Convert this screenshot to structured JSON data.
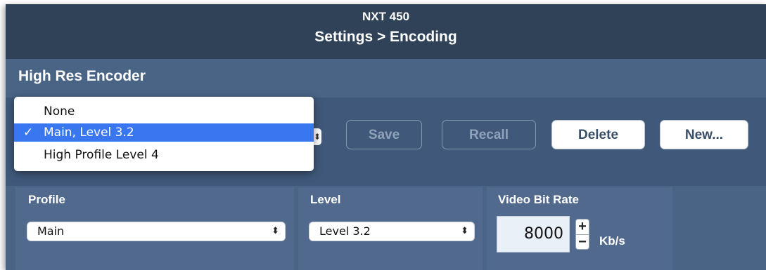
{
  "window": {
    "device": "NXT 450",
    "breadcrumb": "Settings > Encoding"
  },
  "section": {
    "title": "High Res Encoder"
  },
  "preset_menu": {
    "options": [
      "None",
      "Main, Level 3.2",
      "High Profile Level 4"
    ],
    "selected": "Main, Level 3.2",
    "check_glyph": "✓"
  },
  "toolbar": {
    "save_label": "Save",
    "recall_label": "Recall",
    "delete_label": "Delete",
    "new_label": "New..."
  },
  "profile": {
    "label": "Profile",
    "value": "Main"
  },
  "level": {
    "label": "Level",
    "value": "Level 3.2"
  },
  "bitrate": {
    "label": "Video Bit Rate",
    "value": "8000",
    "unit": "Kb/s",
    "plus": "+",
    "minus": "−"
  },
  "glyphs": {
    "updown": "⬍"
  },
  "colors": {
    "titlebar": "#2f4258",
    "panel": "#51698c",
    "menu_selection": "#3877f0"
  }
}
